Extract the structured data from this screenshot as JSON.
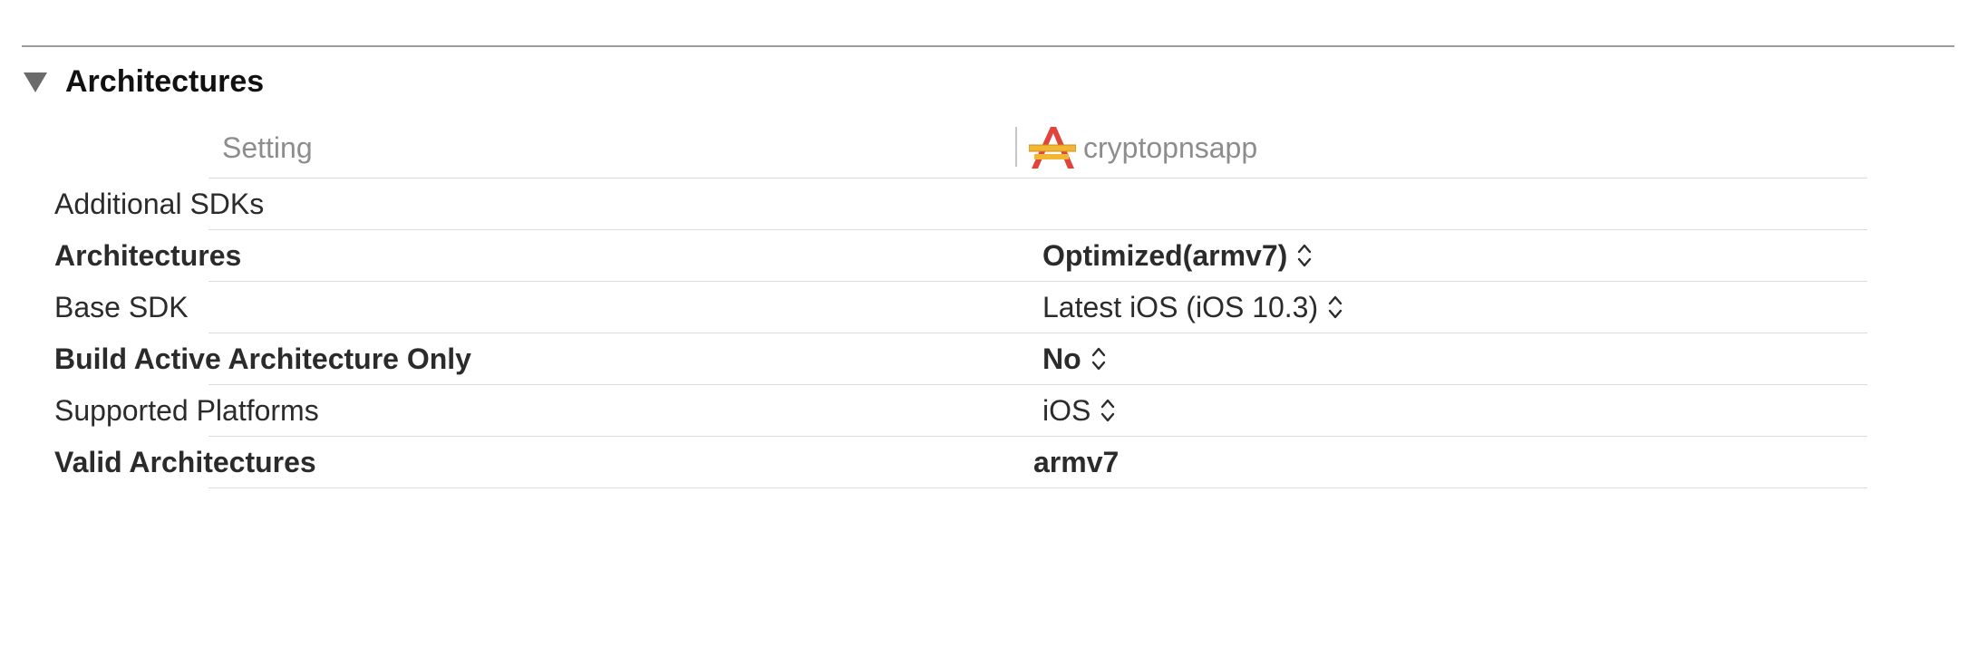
{
  "section": {
    "title": "Architectures"
  },
  "columns": {
    "setting": "Setting",
    "target": "cryptopnsapp"
  },
  "rows": [
    {
      "name": "Additional SDKs",
      "value": "",
      "bold": false,
      "stepper": false
    },
    {
      "name": "Architectures",
      "value": "Optimized(armv7)",
      "bold": true,
      "stepper": true
    },
    {
      "name": "Base SDK",
      "value": "Latest iOS (iOS 10.3)",
      "bold": false,
      "stepper": true
    },
    {
      "name": "Build Active Architecture Only",
      "value": "No",
      "bold": true,
      "stepper": true
    },
    {
      "name": "Supported Platforms",
      "value": "iOS",
      "bold": false,
      "stepper": true
    },
    {
      "name": "Valid Architectures",
      "value": "armv7",
      "bold": true,
      "stepper": false
    }
  ],
  "icons": {
    "disclosure": "disclosure-triangle-icon",
    "target": "xcode-app-icon",
    "stepper": "up-down-chevron-icon"
  },
  "colors": {
    "icon_red": "#e0443b",
    "icon_yellow": "#f2b632"
  }
}
